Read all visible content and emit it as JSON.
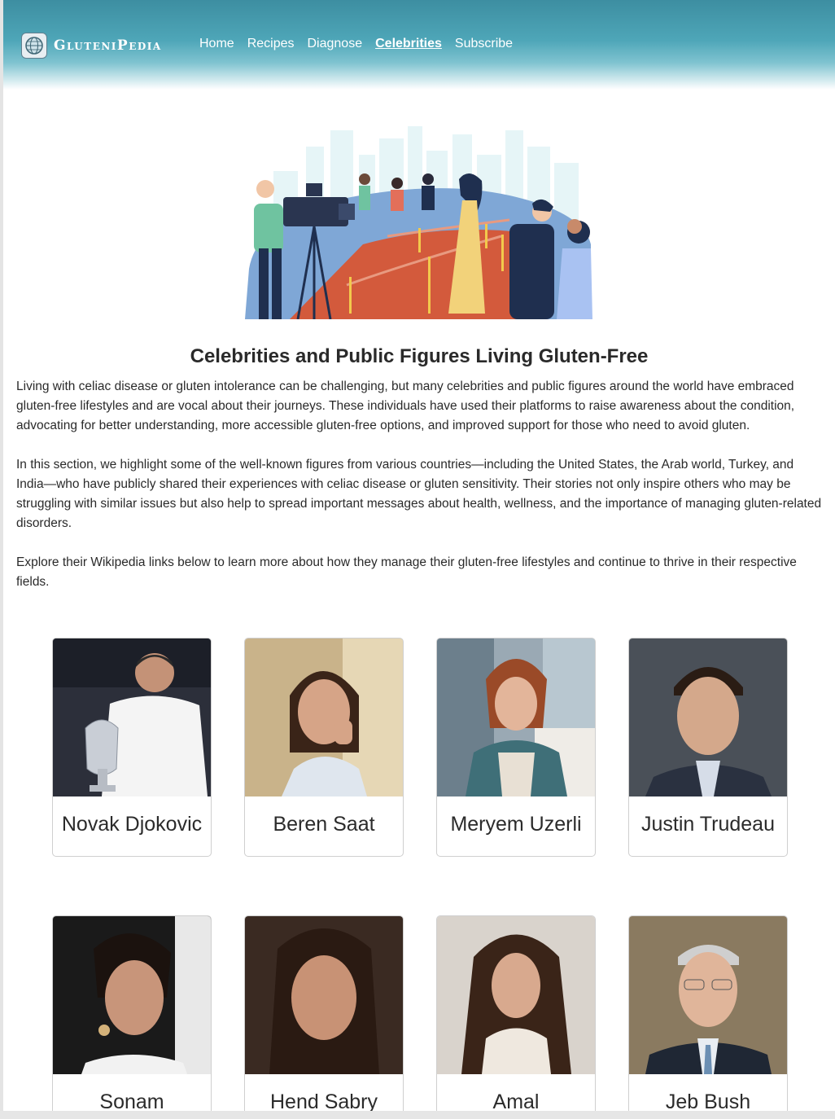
{
  "header": {
    "brand": "GluteniPedia",
    "nav": [
      {
        "label": "Home",
        "active": false
      },
      {
        "label": "Recipes",
        "active": false
      },
      {
        "label": "Diagnose",
        "active": false
      },
      {
        "label": "Celebrities",
        "active": true
      },
      {
        "label": "Subscribe",
        "active": false
      }
    ]
  },
  "main": {
    "title": "Celebrities and Public Figures Living Gluten-Free",
    "paragraphs": [
      "Living with celiac disease or gluten intolerance can be challenging, but many celebrities and public figures around the world have embraced gluten-free lifestyles and are vocal about their journeys. These individuals have used their platforms to raise awareness about the condition, advocating for better understanding, more accessible gluten-free options, and improved support for those who need to avoid gluten.",
      "In this section, we highlight some of the well-known figures from various countries—including the United States, the Arab world, Turkey, and India—who have publicly shared their experiences with celiac disease or gluten sensitivity. Their stories not only inspire others who may be struggling with similar issues but also help to spread important messages about health, wellness, and the importance of managing gluten-related disorders.",
      "Explore their Wikipedia links below to learn more about how they manage their gluten-free lifestyles and continue to thrive in their respective fields."
    ],
    "celebrities": [
      {
        "name": "Novak Djokovic"
      },
      {
        "name": "Beren Saat"
      },
      {
        "name": "Meryem Uzerli"
      },
      {
        "name": "Justin Trudeau"
      },
      {
        "name": "Sonam"
      },
      {
        "name": "Hend Sabry"
      },
      {
        "name": "Amal"
      },
      {
        "name": "Jeb Bush"
      }
    ]
  },
  "colors": {
    "header_top": "#3d8ea1",
    "header_mid": "#4ea6b8",
    "accent_red_carpet": "#d35a3c"
  }
}
